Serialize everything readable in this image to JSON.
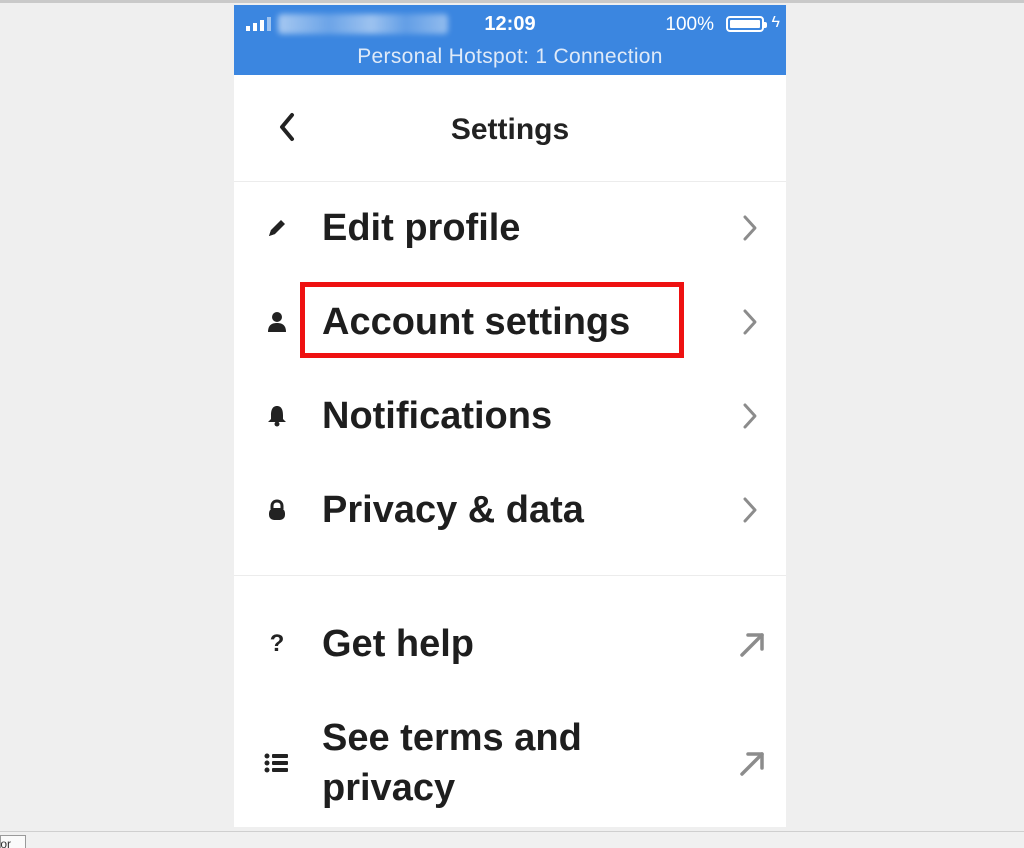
{
  "status_bar": {
    "time": "12:09",
    "battery": "100%",
    "hotspot": "Personal Hotspot: 1 Connection",
    "color": "#3b86e0"
  },
  "nav": {
    "title": "Settings",
    "back_icon": "chevron-left-icon"
  },
  "menu_primary": [
    {
      "label": "Edit profile",
      "icon": "pencil-icon",
      "action_icon": "chevron-right-icon"
    },
    {
      "label": "Account settings",
      "icon": "person-icon",
      "action_icon": "chevron-right-icon"
    },
    {
      "label": "Notifications",
      "icon": "bell-icon",
      "action_icon": "chevron-right-icon"
    },
    {
      "label": "Privacy & data",
      "icon": "lock-icon",
      "action_icon": "chevron-right-icon"
    }
  ],
  "menu_secondary": [
    {
      "label": "Get help",
      "icon": "question-icon",
      "action_icon": "external-arrow-icon"
    },
    {
      "label_line1": "See terms and",
      "label_line2": "privacy",
      "icon": "list-icon",
      "action_icon": "external-arrow-icon"
    }
  ],
  "highlight": {
    "target": "Account settings",
    "color": "#ee1111"
  },
  "taskbar": {
    "tab_label": "tor"
  }
}
